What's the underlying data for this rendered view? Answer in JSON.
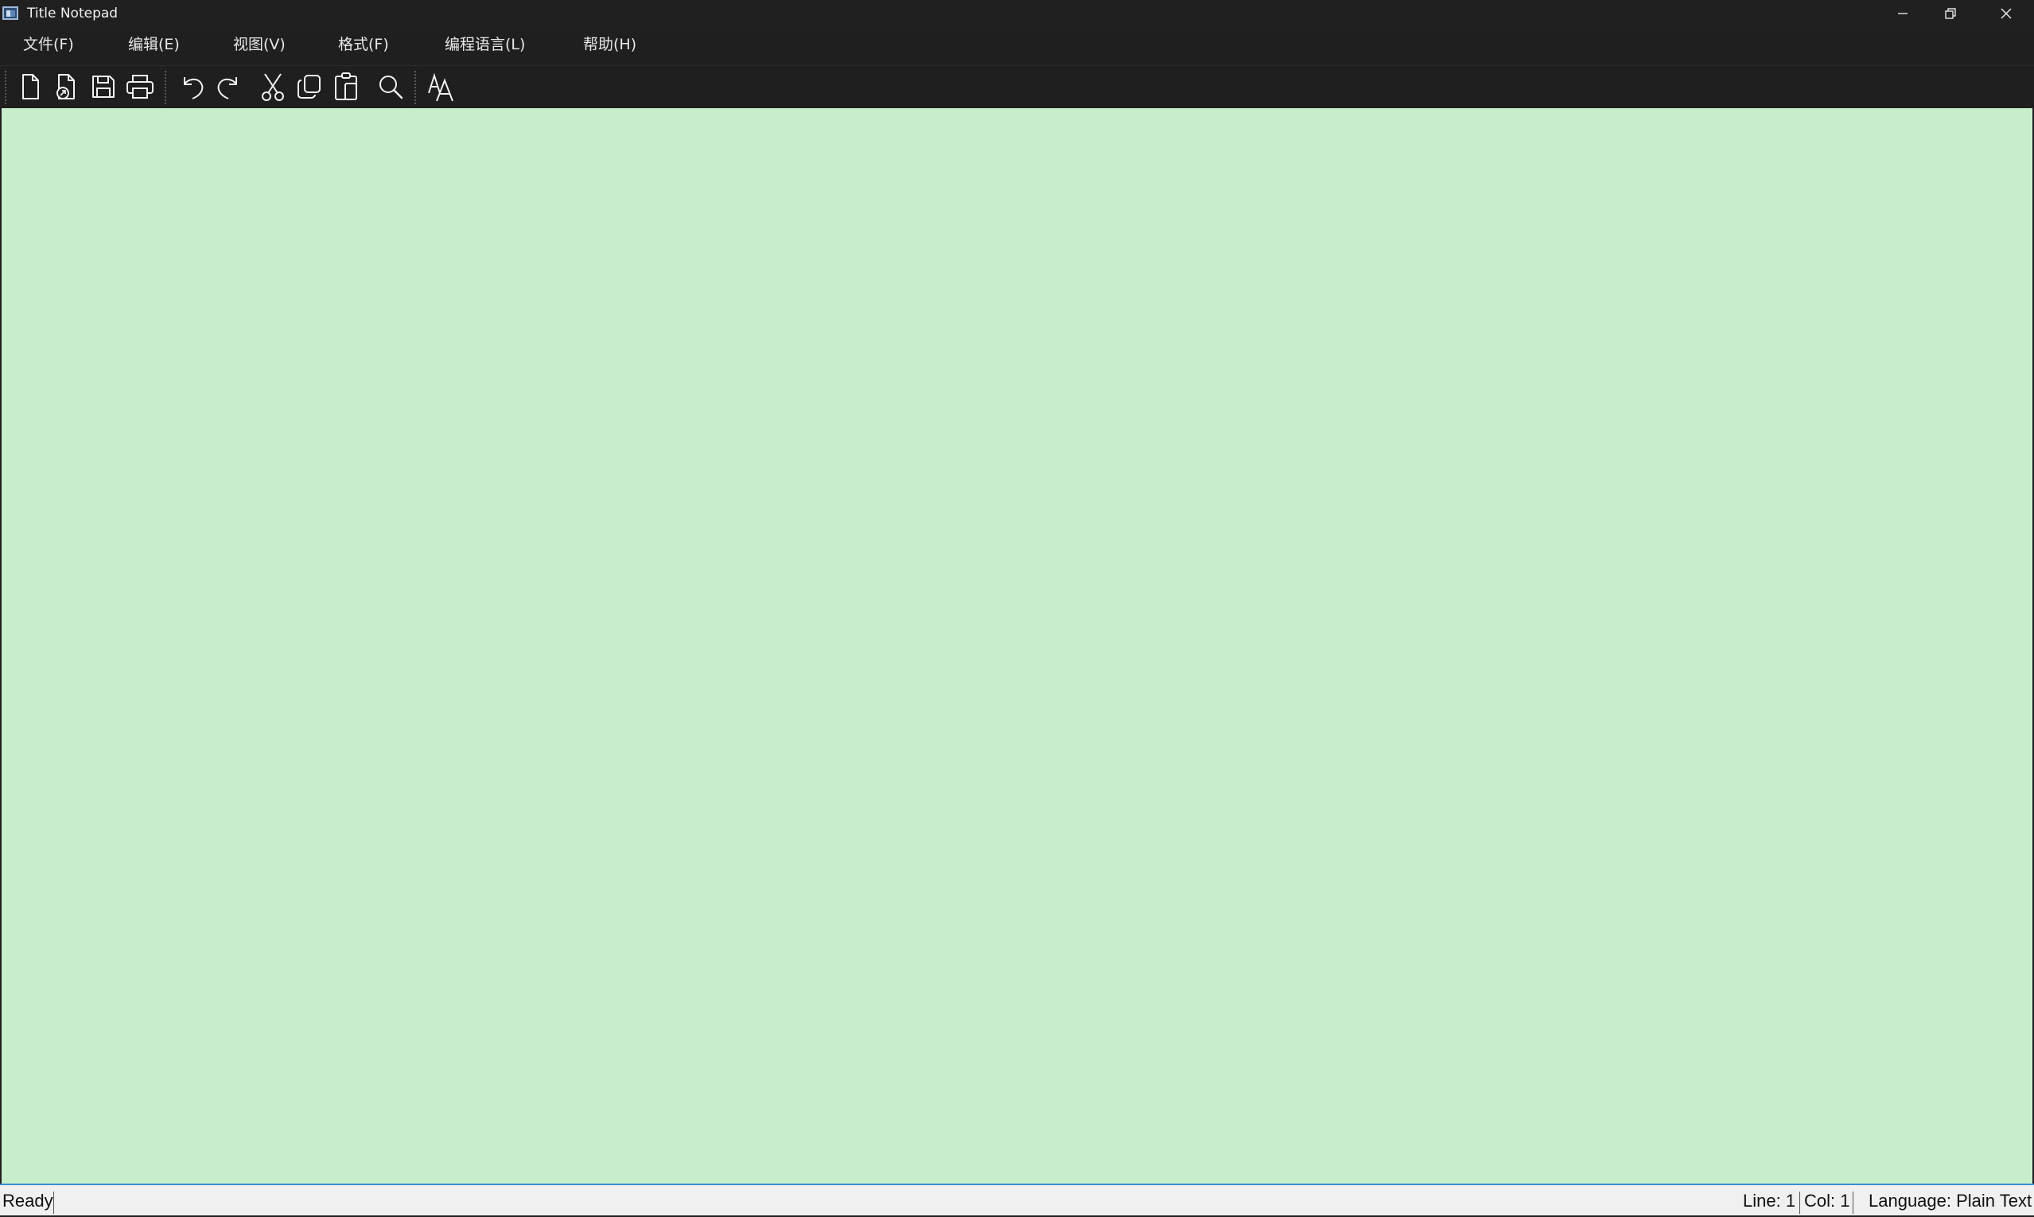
{
  "window": {
    "title": "Title Notepad"
  },
  "menu": {
    "items": [
      {
        "label": "文件(F)"
      },
      {
        "label": "编辑(E)"
      },
      {
        "label": "视图(V)"
      },
      {
        "label": "格式(F)"
      },
      {
        "label": "编程语言(L)"
      },
      {
        "label": "帮助(H)"
      }
    ]
  },
  "toolbar": {
    "buttons": [
      {
        "icon": "new-file-icon"
      },
      {
        "icon": "open-file-icon"
      },
      {
        "icon": "save-icon"
      },
      {
        "icon": "print-icon"
      },
      {
        "icon": "undo-icon"
      },
      {
        "icon": "redo-icon"
      },
      {
        "icon": "cut-icon"
      },
      {
        "icon": "copy-icon"
      },
      {
        "icon": "paste-icon"
      },
      {
        "icon": "search-icon"
      },
      {
        "icon": "font-icon"
      }
    ]
  },
  "editor": {
    "content": "",
    "background": "#c8edcc"
  },
  "status": {
    "state": "Ready",
    "line": "Line: 1",
    "col": "Col: 1",
    "language": "Language: Plain Text"
  },
  "colors": {
    "chrome": "#1f1f1f",
    "editor_bg": "#c8edcc",
    "accent": "#3b8fd0",
    "statusbar": "#f0f0f0"
  }
}
